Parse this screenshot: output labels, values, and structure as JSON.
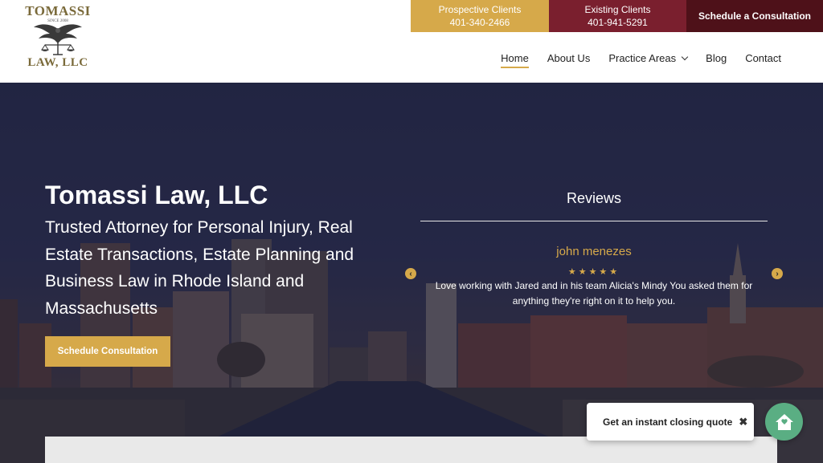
{
  "logo": {
    "top_text": "TOMASSI",
    "since": "SINCE 2008",
    "bottom_text": "LAW, LLC"
  },
  "cta": {
    "prospective": {
      "label": "Prospective Clients",
      "phone": "401-340-2466"
    },
    "existing": {
      "label": "Existing Clients",
      "phone": "401-941-5291"
    },
    "schedule": {
      "label": "Schedule a Consultation"
    }
  },
  "nav": {
    "home": "Home",
    "about": "About Us",
    "practice": "Practice Areas",
    "blog": "Blog",
    "contact": "Contact"
  },
  "hero": {
    "title": "Tomassi Law, LLC",
    "subtitle": "Trusted Attorney for Personal Injury, Real Estate Transactions, Estate Planning and Business Law in Rhode Island and Massachusetts",
    "button": "Schedule Consultation"
  },
  "reviews": {
    "title": "Reviews",
    "name": "john menezes",
    "stars": "★★★★★",
    "rating": 5,
    "text": "Love working with Jared and in his team Alicia's Mindy You asked them for anything they're right on it to help you."
  },
  "widget": {
    "quote_label": "Get an instant closing quote",
    "close_glyph": "✖"
  },
  "colors": {
    "gold": "#d6a94a",
    "maroon": "#7a1f2e",
    "dark_maroon": "#4e1119",
    "green": "#5aae83"
  }
}
